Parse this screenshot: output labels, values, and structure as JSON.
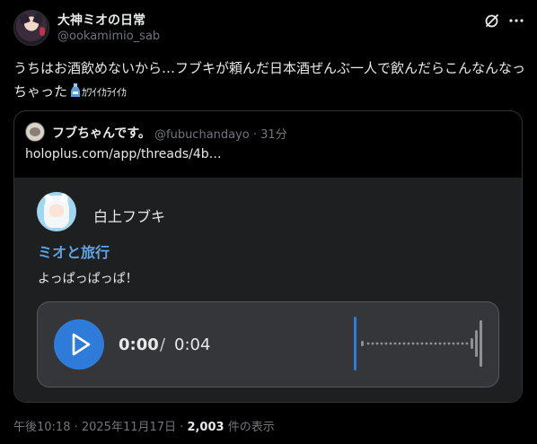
{
  "author": {
    "display_name": "大神ミオの日常",
    "handle": "@ookamimio_sab"
  },
  "tweet": {
    "text": "うちはお酒飲めないから…フブキが頼んだ日本酒ぜんぶ一人で飲んだらこんなんなっちゃった",
    "suffix": "ｶﾜｲｲｶﾗｲｲｶ"
  },
  "quote": {
    "name": "フブちゃんです。",
    "meta": "@fubuchandayo · 31分",
    "link": "holoplus.com/app/threads/4b…",
    "embed": {
      "author": "白上フブキ",
      "title": "ミオと旅行",
      "body": "よっぱっぱっぱ！",
      "audio": {
        "current": "0:00",
        "separator": "/",
        "total": "0:04",
        "progress": 0
      }
    }
  },
  "footer": {
    "time": "午後10:18 · 2025年11月17日 · ",
    "views_count": "2,003",
    "views_label": " 件の表示"
  },
  "colors": {
    "accent": "#2f7bd9",
    "link_title": "#5ba4e6",
    "muted": "#71767b"
  }
}
